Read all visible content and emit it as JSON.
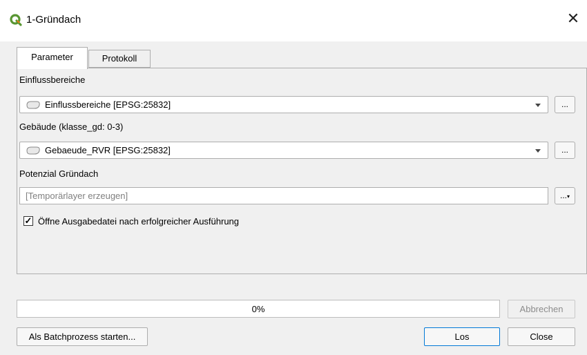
{
  "window": {
    "title": "1-Gründach",
    "app_icon": "qgis-icon",
    "close_glyph": "✕"
  },
  "tabs": [
    {
      "label": "Parameter",
      "active": true
    },
    {
      "label": "Protokoll",
      "active": false
    }
  ],
  "parameters": {
    "einfluss_label": "Einflussbereiche",
    "einfluss_value": "Einflussbereiche [EPSG:25832]",
    "gebaeude_label": "Gebäude (klasse_gd: 0-3)",
    "gebaeude_value": "Gebaeude_RVR [EPSG:25832]",
    "output_label": "Potenzial Gründach",
    "output_placeholder": "[Temporärlayer erzeugen]",
    "browse_label": "...",
    "open_output_label": "Öffne Ausgabedatei nach erfolgreicher Ausführung",
    "open_output_checked": true
  },
  "progress": {
    "percent": 0,
    "text": "0%"
  },
  "buttons": {
    "cancel": "Abbrechen",
    "batch": "Als Batchprozess starten...",
    "run": "Los",
    "close": "Close"
  },
  "colors": {
    "qgis_green": "#589632",
    "qgis_yellow": "#ee7913",
    "progress_fill": "#06b025",
    "focus_border": "#0078d7"
  }
}
